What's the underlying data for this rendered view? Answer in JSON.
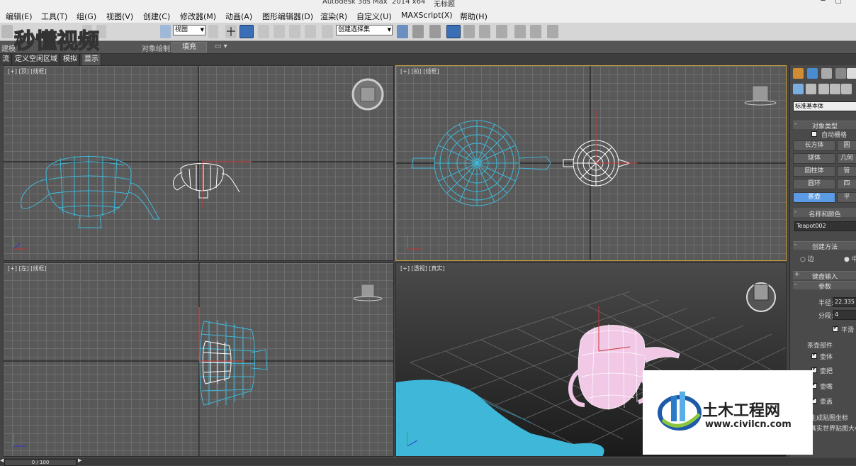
{
  "window": {
    "title": "Autodesk 3ds Max  2014 x64",
    "doc": "无标题"
  },
  "menu": [
    "编辑(E)",
    "工具(T)",
    "组(G)",
    "视图(V)",
    "创建(C)",
    "修改器(M)",
    "动画(A)",
    "图形编辑器(D)",
    "渲染(R)",
    "自定义(U)",
    "MAXScript(X)",
    "帮助(H)"
  ],
  "toolbar": {
    "view_select": "视图",
    "selection_set": "创建选择集"
  },
  "ribbon": {
    "left_label": "建模",
    "fill_label": "填充",
    "obj_label": "对象绘制"
  },
  "tabs": [
    "流",
    "定义空闲区域",
    "模拟",
    "显示"
  ],
  "viewports": {
    "top": "[+] [顶] [线框]",
    "front": "[+] [前] [线框]",
    "left": "[+] [左] [线框]",
    "persp": "[+] [透视] [真实]"
  },
  "cmd": {
    "dropdown": "标准基本体",
    "object_type": "对象类型",
    "auto_grid": "自动栅格",
    "buttons": [
      [
        "长方体",
        "圆"
      ],
      [
        "球体",
        "几何"
      ],
      [
        "圆柱体",
        "管"
      ],
      [
        "圆环",
        "四"
      ],
      [
        "茶壶",
        "平"
      ]
    ],
    "name_color": "名称和颜色",
    "name_value": "Teapot002",
    "create_method": "创建方法",
    "method_edge": "边",
    "method_center": "中",
    "keyboard": "键盘输入",
    "params": "参数",
    "radius_label": "半径:",
    "radius_value": "22.335",
    "segments_label": "分段:",
    "segments_value": "4",
    "smooth": "平滑",
    "parts": "茶壶部件",
    "part_body": "壶体",
    "part_handle": "壶把",
    "part_spout": "壶嘴",
    "part_lid": "壶盖",
    "gen_map": "生成贴图坐标",
    "real_world": "真实世界贴图大小"
  },
  "status": {
    "frame": "0 / 100"
  },
  "watermarks": {
    "left": "秒懂视频",
    "right_cn": "土木工程网",
    "right_url": "www.civilcn.com"
  },
  "colors": {
    "accent": "#5b9be6",
    "teapot_blue": "#3fb7d8",
    "teapot_pink": "#f1c8e6",
    "active_border": "#c8a039"
  }
}
